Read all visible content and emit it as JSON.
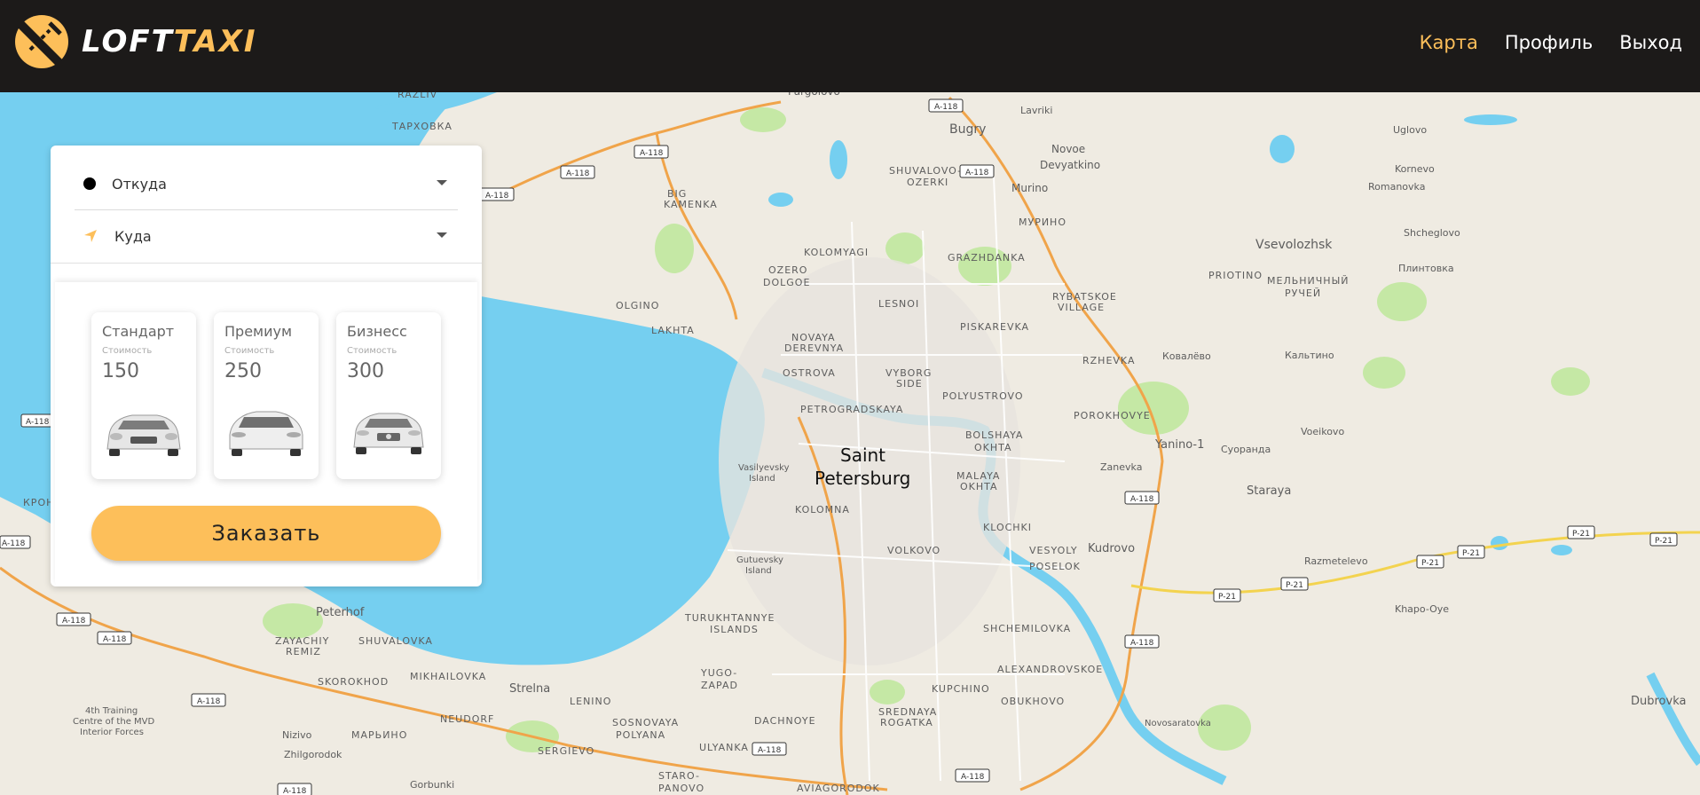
{
  "header": {
    "logo_text_white": "LOFT",
    "logo_text_yellow": "TAXI",
    "nav": [
      {
        "label": "Карта",
        "active": true
      },
      {
        "label": "Профиль",
        "active": false
      },
      {
        "label": "Выход",
        "active": false
      }
    ]
  },
  "order": {
    "from_placeholder": "Откуда",
    "to_placeholder": "Куда",
    "tariffs": [
      {
        "name": "Стандарт",
        "cost_label": "Стоимость",
        "price": "150"
      },
      {
        "name": "Премиум",
        "cost_label": "Стоимость",
        "price": "250"
      },
      {
        "name": "Бизнесс",
        "cost_label": "Стоимость",
        "price": "300"
      }
    ],
    "submit_label": "Заказать"
  },
  "map": {
    "city": [
      "Saint",
      "Petersburg"
    ],
    "labels": [
      "Pargolovo",
      "A-118",
      "Lavriki",
      "Bugry",
      "Novoe",
      "Devyatkino",
      "Murino",
      "Uglovo",
      "Kornevo",
      "Romanovka",
      "Vsevolozhsk",
      "Shcheglovo",
      "Плинтовка",
      "PRIOTINO",
      "МЕЛЬНИЧНЫЙ",
      "РУЧЕЙ",
      "SHUVALOVO-",
      "OZERKI",
      "BIG",
      "KAMENKA",
      "KOLOMYAGI",
      "GRAZHDANKA",
      "OZERO",
      "DOLGOE",
      "OLGINO",
      "LAKHTA",
      "LESNOI",
      "PISKAREVKA",
      "NOVAYA",
      "DEREVNYA",
      "OSTROVA",
      "VYBORG",
      "SIDE",
      "POLYUSTROVO",
      "RYBATSKOE",
      "VILLAGE",
      "RZHEVKA",
      "Ковалёво",
      "Кальтино",
      "PETROGRADSKAYA",
      "POROKHOVYE",
      "Vasilyevsky",
      "Island",
      "BOLSHAYA",
      "OKHTA",
      "MALAYA",
      "Yanino-1",
      "Суоранда",
      "Voeikovo",
      "Zanevka",
      "Staraya",
      "KOLOMNA",
      "KLOCHKI",
      "Kudrovo",
      "VOLKOVO",
      "VESYOLY",
      "POSELOK",
      "Gutuevsky",
      "Razmetelevo",
      "P-21",
      "Khapo-Oye",
      "TURUKHTANNYE",
      "ISLANDS",
      "SHCHEMILOVKA",
      "Peterhof",
      "ZAYACHIY",
      "REMIZ",
      "SHUVALOVKA",
      "SKOROKHOD",
      "MIKHAILOVKA",
      "Strelna",
      "YUGO-",
      "ZAPAD",
      "LENINO",
      "SOSNOVAYA",
      "POLYANA",
      "DACHNOYE",
      "SREDNAYA",
      "ROGATKA",
      "KUPCHINO",
      "ALEXANDROVSKOE",
      "OBUKHOVO",
      "4th Training",
      "Centre of the MVD",
      "Interior Forces",
      "NEUDORF",
      "МАРЬИНО",
      "Nizivo",
      "Zhilgorodok",
      "SERGIEVO",
      "ULYANKA",
      "STARO-",
      "PANOVO",
      "AVIAGORODOK",
      "Gorbunki",
      "Novosaratovka",
      "Dubrovka",
      "ТАРХОВКА",
      "RAZLIV",
      "КРОН",
      "МУРИНО"
    ]
  }
}
